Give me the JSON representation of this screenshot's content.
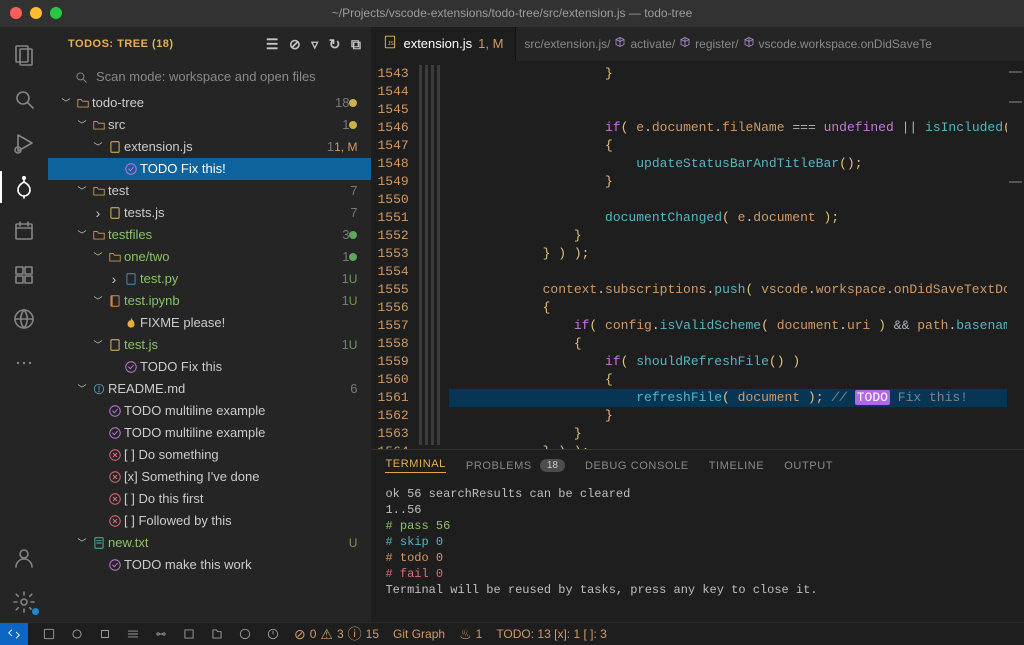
{
  "window_title": "~/Projects/vscode-extensions/todo-tree/src/extension.js — todo-tree",
  "sidebar": {
    "header": "TODOS: TREE (18)",
    "scan_label": "Scan mode: workspace and open files",
    "rows": [
      {
        "depth": 0,
        "chev": "˅",
        "icon": "folder",
        "label": "todo-tree",
        "count": "18",
        "badge": "●",
        "badge_kind": "dot-yellow"
      },
      {
        "depth": 1,
        "chev": "˅",
        "icon": "folder",
        "label": "src",
        "count": "1",
        "badge": "●",
        "badge_kind": "dot-yellow"
      },
      {
        "depth": 2,
        "chev": "˅",
        "icon": "js",
        "label": "extension.js",
        "count": "1",
        "badge": "1, M",
        "badge_kind": "orange",
        "selected_file": true
      },
      {
        "depth": 3,
        "chev": "",
        "icon": "tag-check",
        "label": "TODO Fix this!",
        "selected": true
      },
      {
        "depth": 1,
        "chev": "˅",
        "icon": "folder",
        "label": "test",
        "count": "7"
      },
      {
        "depth": 2,
        "chev": "›",
        "icon": "js",
        "label": "tests.js",
        "count": "7"
      },
      {
        "depth": 1,
        "chev": "˅",
        "icon": "folder",
        "label": "testfiles",
        "count": "3",
        "label_cls": "green",
        "badge": "●",
        "badge_kind": "dot-green"
      },
      {
        "depth": 2,
        "chev": "˅",
        "icon": "folder",
        "label": "one/two",
        "count": "1",
        "label_cls": "green",
        "badge": "●",
        "badge_kind": "dot-green"
      },
      {
        "depth": 3,
        "chev": "›",
        "icon": "py",
        "label": "test.py",
        "count": "1",
        "label_cls": "green",
        "badge": "U",
        "badge_kind": "unt"
      },
      {
        "depth": 2,
        "chev": "˅",
        "icon": "nb",
        "label": "test.ipynb",
        "count": "1",
        "label_cls": "green",
        "badge": "U",
        "badge_kind": "unt"
      },
      {
        "depth": 3,
        "chev": "",
        "icon": "tag-fire",
        "label": "FIXME please!"
      },
      {
        "depth": 2,
        "chev": "˅",
        "icon": "js",
        "label": "test.js",
        "count": "1",
        "label_cls": "green",
        "badge": "U",
        "badge_kind": "unt"
      },
      {
        "depth": 3,
        "chev": "",
        "icon": "tag-check",
        "label": "TODO Fix this"
      },
      {
        "depth": 1,
        "chev": "˅",
        "icon": "md",
        "label": "README.md",
        "count": "6"
      },
      {
        "depth": 2,
        "chev": "",
        "icon": "tag-check",
        "label": "TODO multiline example"
      },
      {
        "depth": 2,
        "chev": "",
        "icon": "tag-check",
        "label": "TODO multiline example"
      },
      {
        "depth": 2,
        "chev": "",
        "icon": "tag-cross",
        "label": "[ ] Do something"
      },
      {
        "depth": 2,
        "chev": "",
        "icon": "tag-cross",
        "label": "[x] Something I've done"
      },
      {
        "depth": 2,
        "chev": "",
        "icon": "tag-cross",
        "label": "[ ] Do this first"
      },
      {
        "depth": 2,
        "chev": "",
        "icon": "tag-cross",
        "label": "[ ] Followed by this"
      },
      {
        "depth": 1,
        "chev": "˅",
        "icon": "txt",
        "label": "new.txt",
        "label_cls": "green",
        "badge": "U",
        "badge_kind": "unt"
      },
      {
        "depth": 2,
        "chev": "",
        "icon": "tag-check",
        "label": "TODO make this work"
      }
    ]
  },
  "tab": {
    "file_icon": "js",
    "name": "extension.js",
    "status": "1, M"
  },
  "breadcrumbs": [
    {
      "text": "src/extension.js/"
    },
    {
      "cube": true,
      "text": "activate/"
    },
    {
      "cube": true,
      "text": "register/"
    },
    {
      "cube": true,
      "text": "vscode.workspace.onDidSaveTe"
    }
  ],
  "editor": {
    "first_line": 1543,
    "highlight_line": 1561,
    "lines": [
      "                    }",
      "",
      "",
      "                    if( e.document.fileName === undefined || isIncluded( e.document )",
      "                    {",
      "                        updateStatusBarAndTitleBar();",
      "                    }",
      "",
      "                    documentChanged( e.document );",
      "                }",
      "            } ) );",
      "",
      "            context.subscriptions.push( vscode.workspace.onDidSaveTextDocument(",
      "            {",
      "                if( config.isValidScheme( document.uri ) && path.basename( document",
      "                {",
      "                    if( shouldRefreshFile() )",
      "                    {",
      "                        refreshFile( document ); // TODO Fix this!",
      "                    }",
      "                }",
      "            } ) );"
    ]
  },
  "panel": {
    "tabs": {
      "terminal": "TERMINAL",
      "problems": "PROBLEMS",
      "problems_badge": "18",
      "debug": "DEBUG CONSOLE",
      "timeline": "TIMELINE",
      "output": "OUTPUT"
    },
    "terminal_lines": [
      {
        "cls": "c-grey",
        "text": "ok 56 searchResults can be cleared"
      },
      {
        "cls": "c-grey",
        "text": "1..56"
      },
      {
        "cls": "c-green",
        "text": "# pass 56"
      },
      {
        "cls": "c-cyan",
        "text": "# skip 0"
      },
      {
        "cls": "c-yel",
        "text": "# todo 0"
      },
      {
        "cls": "c-red",
        "text": "# fail 0"
      },
      {
        "cls": "c-grey",
        "text": ""
      },
      {
        "cls": "c-grey",
        "text": "Terminal will be reused by tasks, press any key to close it."
      }
    ]
  },
  "statusbar": {
    "errors": "0",
    "warn_a": "3",
    "warn_b": "15",
    "git_graph": "Git Graph",
    "flame": "1",
    "todo": "TODO: 13 [x]: 1 [ ]: 3"
  }
}
